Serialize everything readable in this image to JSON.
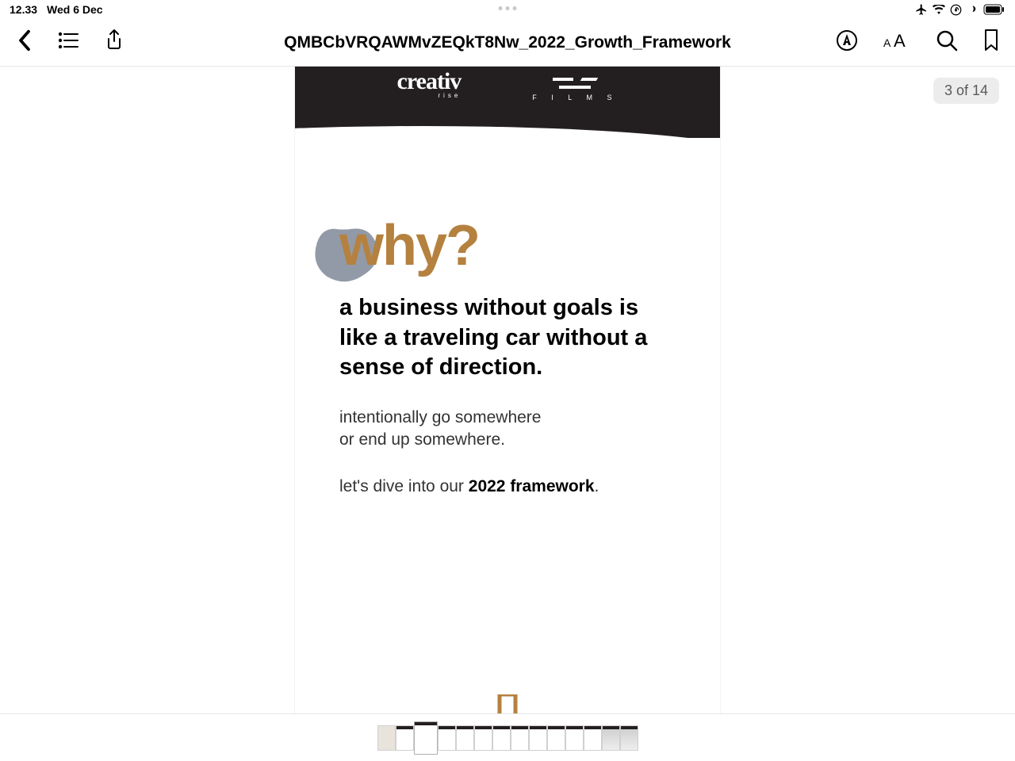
{
  "status": {
    "time": "12.33",
    "date": "Wed 6 Dec"
  },
  "toolbar": {
    "title": "QMBCbVRQAWMvZEQkT8Nw_2022_Growth_Framework"
  },
  "page_indicator": "3 of 14",
  "doc": {
    "logo_left": "creativ",
    "logo_left_sub": "rise",
    "logo_right": "F I L M S",
    "heading": "why?",
    "statement": "a business without goals is like a traveling car without a sense of direction.",
    "para1_line1": "intentionally go somewhere",
    "para1_line2": "or end up somewhere.",
    "para2_prefix": "let's dive into our ",
    "para2_bold": "2022 framework",
    "para2_suffix": "."
  },
  "thumbnails": {
    "count": 14,
    "current": 3
  }
}
